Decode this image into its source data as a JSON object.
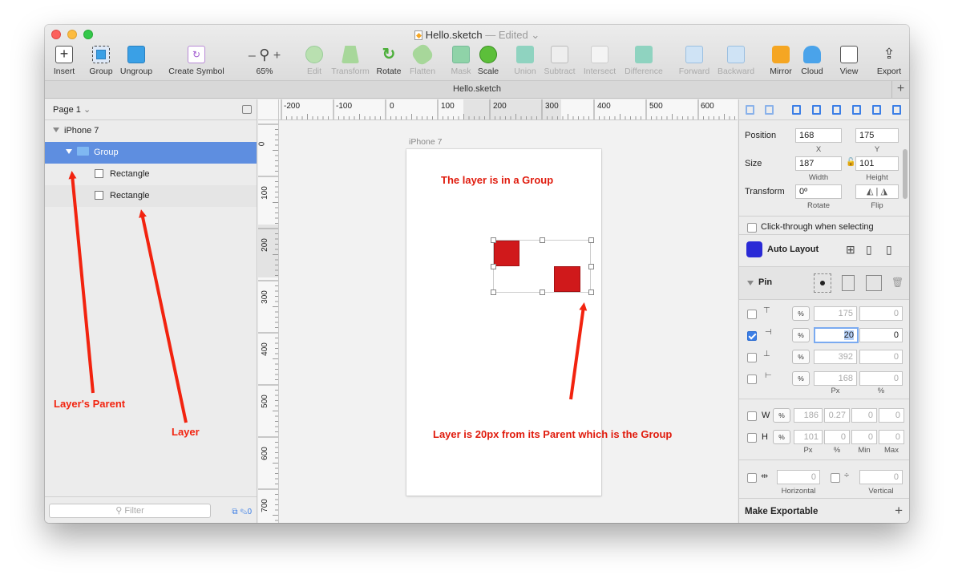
{
  "window": {
    "title": "Hello.sketch",
    "edited_label": "— Edited",
    "tab_title": "Hello.sketch"
  },
  "toolbar": {
    "insert": "Insert",
    "group": "Group",
    "ungroup": "Ungroup",
    "create_symbol": "Create Symbol",
    "zoom_minus": "–",
    "zoom_plus": "+",
    "zoom": "65%",
    "edit": "Edit",
    "transform": "Transform",
    "rotate": "Rotate",
    "flatten": "Flatten",
    "mask": "Mask",
    "scale": "Scale",
    "union": "Union",
    "subtract": "Subtract",
    "intersect": "Intersect",
    "difference": "Difference",
    "forward": "Forward",
    "backward": "Backward",
    "mirror": "Mirror",
    "cloud": "Cloud",
    "view": "View",
    "export": "Export"
  },
  "layers_panel": {
    "page_selector": "Page 1",
    "artboard": "iPhone 7",
    "group": "Group",
    "rect1": "Rectangle",
    "rect2": "Rectangle",
    "filter_placeholder": "Filter",
    "filter_count": "0"
  },
  "rulers": {
    "top": [
      "-200",
      "-100",
      "0",
      "100",
      "200",
      "300",
      "400",
      "500",
      "600"
    ],
    "left": [
      "0",
      "100",
      "200",
      "300",
      "400",
      "500",
      "600",
      "700"
    ]
  },
  "canvas": {
    "artboard_label": "iPhone 7",
    "text_group": "The layer is in a Group",
    "text_distance": "Layer is 20px from its Parent which is the Group",
    "rect_color": "#d0191b"
  },
  "annotations": {
    "parent": "Layer's Parent",
    "layer": "Layer",
    "arrow_color": "#f2230f"
  },
  "inspector": {
    "position_label": "Position",
    "x": "168",
    "y": "175",
    "x_label": "X",
    "y_label": "Y",
    "size_label": "Size",
    "width": "187",
    "height": "101",
    "width_label": "Width",
    "height_label": "Height",
    "transform_label": "Transform",
    "rotate": "0º",
    "rotate_label": "Rotate",
    "flip_label": "Flip",
    "click_through": "Click-through when selecting",
    "auto_layout": "Auto Layout",
    "pin": "Pin",
    "pct": "%",
    "pin_rows": [
      {
        "value": "175",
        "second": "0",
        "checked": false
      },
      {
        "value": "20",
        "second": "0",
        "checked": true
      },
      {
        "value": "392",
        "second": "0",
        "checked": false
      },
      {
        "value": "168",
        "second": "0",
        "checked": false
      }
    ],
    "px_label": "Px",
    "pct_label": "%",
    "w_label": "W",
    "h_label": "H",
    "w_vals": [
      "186",
      "0.27",
      "0",
      "0"
    ],
    "h_vals": [
      "101",
      "0",
      "0",
      "0"
    ],
    "min_label": "Min",
    "max_label": "Max",
    "horizontal_val": "0",
    "vertical_val": "0",
    "horizontal_label": "Horizontal",
    "vertical_label": "Vertical",
    "make_exportable": "Make Exportable",
    "add": "+"
  }
}
